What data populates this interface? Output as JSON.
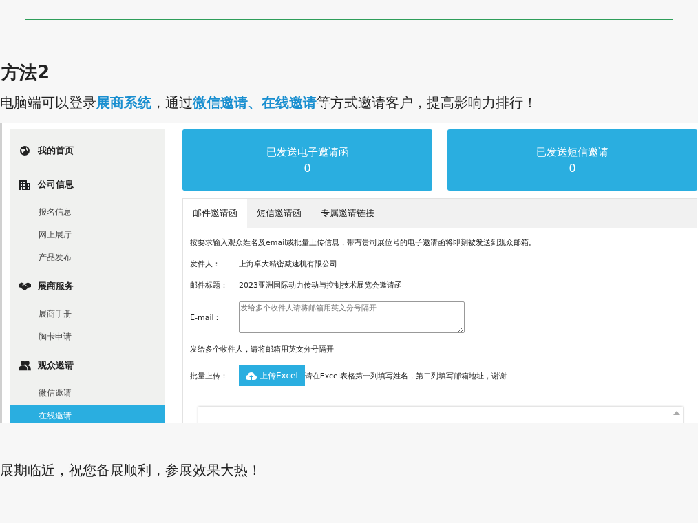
{
  "heading": "方法2",
  "intro": "电脑端可以登录**展商系统**，通过**微信邀请、在线邀请**等方式邀请客户，提高影响力排行！",
  "sidebar": {
    "items": [
      {
        "kind": "section",
        "label": "我的首页"
      },
      {
        "kind": "section",
        "label": "公司信息"
      },
      {
        "kind": "item",
        "label": "报名信息",
        "selected": false
      },
      {
        "kind": "item",
        "label": "网上展厅",
        "selected": false
      },
      {
        "kind": "item",
        "label": "产品发布",
        "selected": false
      },
      {
        "kind": "section",
        "label": "展商服务"
      },
      {
        "kind": "item",
        "label": "展商手册",
        "selected": false
      },
      {
        "kind": "item",
        "label": "胸卡申请",
        "selected": false
      },
      {
        "kind": "section",
        "label": "观众邀请"
      },
      {
        "kind": "item",
        "label": "微信邀请",
        "selected": false
      },
      {
        "kind": "item",
        "label": "在线邀请",
        "selected": true
      }
    ]
  },
  "stats": [
    {
      "label": "已发送电子邀请函",
      "value": "0"
    },
    {
      "label": "已发送短信邀请",
      "value": "0"
    }
  ],
  "tabs": [
    {
      "label": "邮件邀请函",
      "selected": true
    },
    {
      "label": "短信邀请函",
      "selected": false
    },
    {
      "label": "专属邀请链接",
      "selected": false
    }
  ],
  "form": {
    "description": "按要求输入观众姓名及email或批量上传信息，带有贵司展位号的电子邀请函将即刻被发送到观众邮箱。",
    "sender_label": "发件人：",
    "sender": "上海卓大精密减速机有限公司",
    "subject_label": "邮件标题：",
    "subject": "2023亚洲国际动力传动与控制技术展览会邀请函",
    "email_label": "E-mail：",
    "email_placeholder": "发给多个收件人请将邮箱用英文分号隔开",
    "hint": "发给多个收件人，请将邮箱用英文分号隔开",
    "upload_label": "批量上传：",
    "upload_button": "上传Excel",
    "upload_note": "请在Excel表格第一列填写姓名，第二列填写邮箱地址，谢谢"
  },
  "closing": "展期临近，祝您备展顺利，参展效果大热！"
}
